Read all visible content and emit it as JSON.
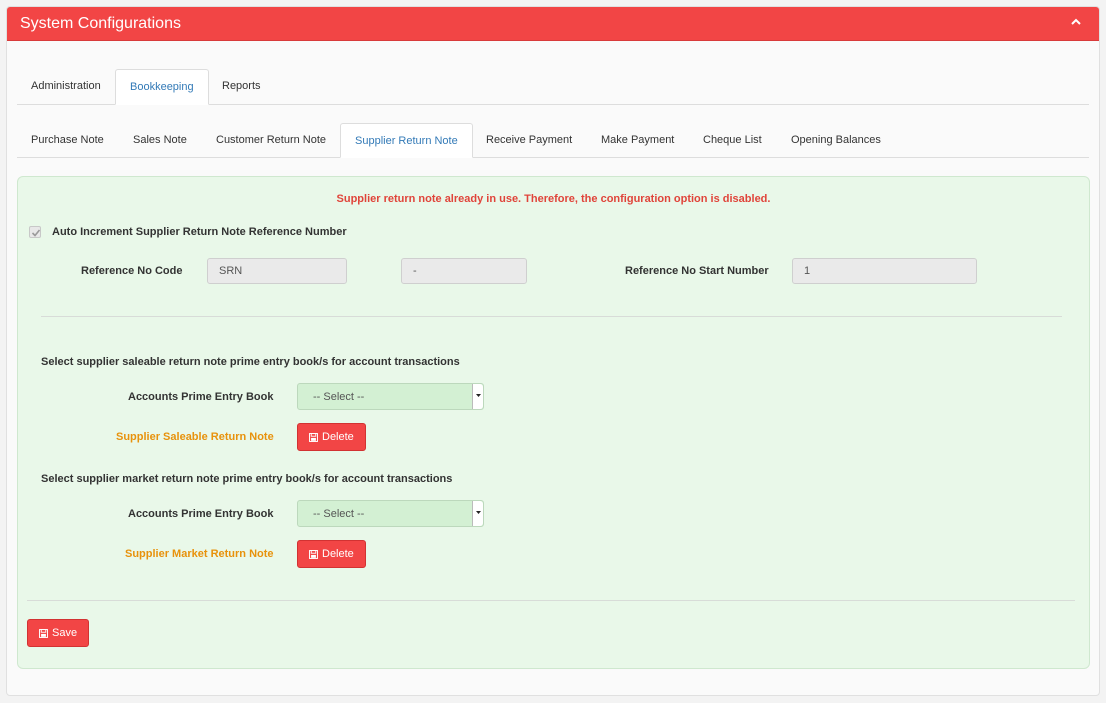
{
  "header": {
    "title": "System Configurations",
    "collapse_icon": "chevron-up-icon"
  },
  "main_tabs": [
    {
      "label": "Administration",
      "active": false
    },
    {
      "label": "Bookkeeping",
      "active": true
    },
    {
      "label": "Reports",
      "active": false
    }
  ],
  "sub_tabs": [
    {
      "label": "Purchase Note",
      "active": false
    },
    {
      "label": "Sales Note",
      "active": false
    },
    {
      "label": "Customer Return Note",
      "active": false
    },
    {
      "label": "Supplier Return Note",
      "active": true
    },
    {
      "label": "Receive Payment",
      "active": false
    },
    {
      "label": "Make Payment",
      "active": false
    },
    {
      "label": "Cheque List",
      "active": false
    },
    {
      "label": "Opening Balances",
      "active": false
    }
  ],
  "warning": "Supplier return note already in use. Therefore, the configuration option is disabled.",
  "auto_increment": {
    "label": "Auto Increment Supplier Return Note Reference Number",
    "checked": true
  },
  "reference": {
    "code_label": "Reference No Code",
    "code_value": "SRN",
    "separator_value": "-",
    "start_label": "Reference No Start Number",
    "start_value": "1"
  },
  "saleable_section": {
    "title": "Select supplier saleable return note prime entry book/s for account transactions",
    "book_label": "Accounts Prime Entry Book",
    "select_value": "-- Select --",
    "note_label": "Supplier Saleable Return Note",
    "delete_label": "Delete"
  },
  "market_section": {
    "title": "Select supplier market return note prime entry book/s for account transactions",
    "book_label": "Accounts Prime Entry Book",
    "select_value": "-- Select --",
    "note_label": "Supplier Market Return Note",
    "delete_label": "Delete"
  },
  "save_label": "Save",
  "colors": {
    "accent": "#f24545",
    "content_bg": "#e9f8e9",
    "warning": "#e0443a",
    "note_label": "#e8920c",
    "active_tab": "#337ab7"
  }
}
